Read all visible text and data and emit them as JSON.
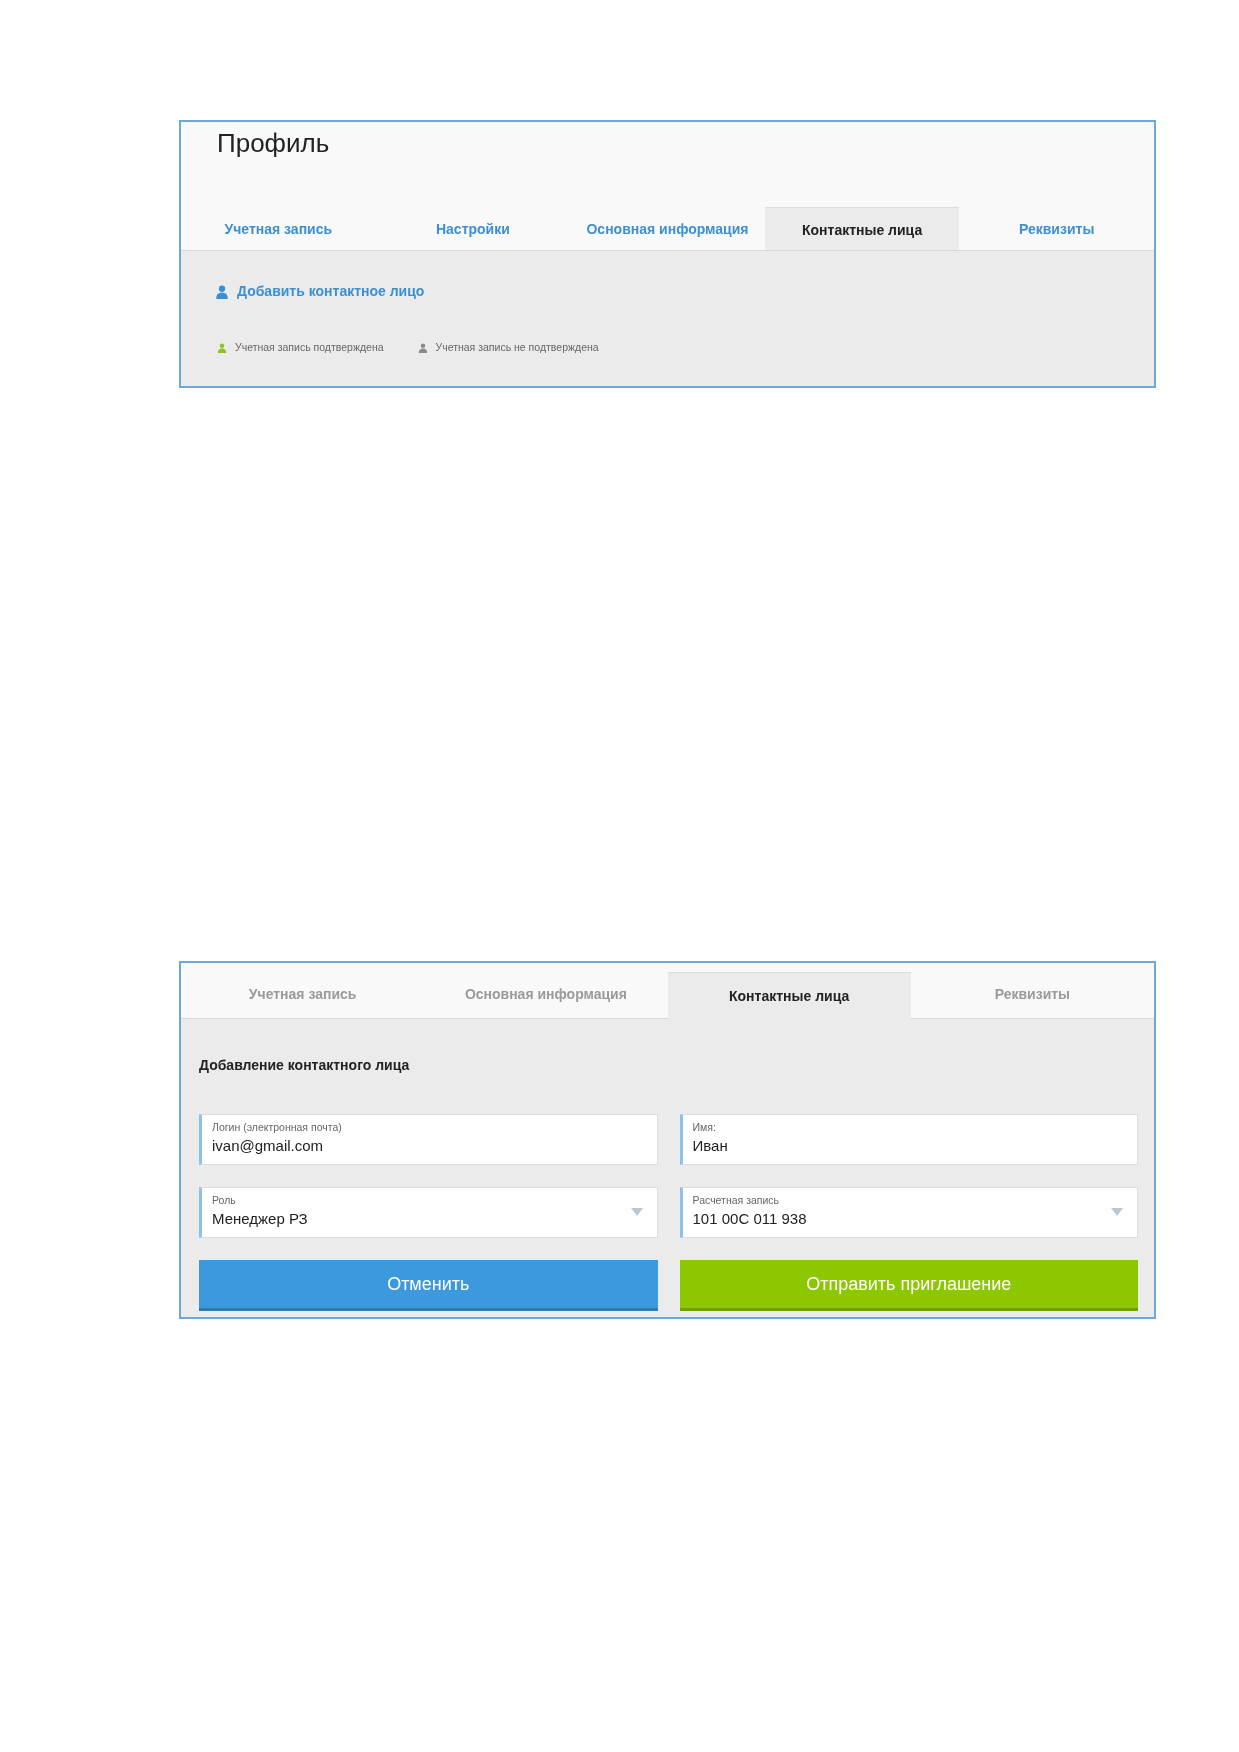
{
  "profile_panel": {
    "title": "Профиль",
    "tabs": [
      {
        "label": "Учетная запись",
        "selected": false,
        "disabled": false
      },
      {
        "label": "Настройки",
        "selected": false,
        "disabled": false
      },
      {
        "label": "Основная информация",
        "selected": false,
        "disabled": false
      },
      {
        "label": "Контактные лица",
        "selected": true,
        "disabled": false
      },
      {
        "label": "Реквизиты",
        "selected": false,
        "disabled": false
      }
    ],
    "add_contact_link": "Добавить контактное лицо",
    "legend": [
      {
        "label": "Учетная запись подтверждена",
        "color": "#8dc21f"
      },
      {
        "label": "Учетная запись не подтверждена",
        "color": "#8a8a8a"
      }
    ]
  },
  "add_contact_panel": {
    "tabs": [
      {
        "label": "Учетная запись",
        "selected": false,
        "disabled": true
      },
      {
        "label": "Основная информация",
        "selected": false,
        "disabled": true
      },
      {
        "label": "Контактные лица",
        "selected": true,
        "disabled": false
      },
      {
        "label": "Реквизиты",
        "selected": false,
        "disabled": true
      }
    ],
    "heading": "Добавление контактного лица",
    "fields": [
      {
        "kind": "text",
        "label": "Логин (электронная почта)",
        "value": "ivan@gmail.com"
      },
      {
        "kind": "text",
        "label": "Имя:",
        "value": "Иван"
      },
      {
        "kind": "select",
        "label": "Роль",
        "value": "Менеджер РЗ"
      },
      {
        "kind": "select",
        "label": "Расчетная запись",
        "value": "101 00C 011 938"
      }
    ],
    "buttons": [
      {
        "kind": "cancel",
        "label": "Отменить"
      },
      {
        "kind": "submit",
        "label": "Отправить приглашение"
      }
    ]
  }
}
